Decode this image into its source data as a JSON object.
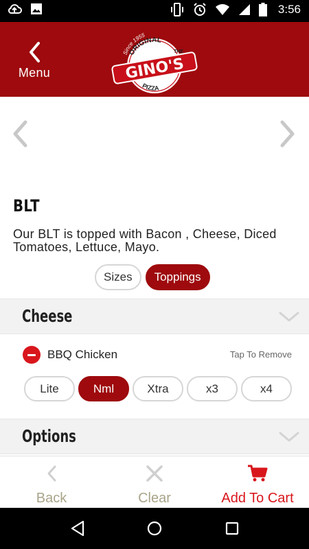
{
  "status_bar": {
    "time": "3:56",
    "icons": [
      "cloud-upload-icon",
      "image-icon",
      "vibrate-icon",
      "alarm-icon",
      "wifi-icon",
      "signal-icon",
      "battery-icon"
    ]
  },
  "header": {
    "back_label": "Menu",
    "logo": {
      "since": "Since 1955",
      "the": "THE",
      "original": "ORIGINAL",
      "brand": "GINO'S",
      "pizza": "PIZZA"
    }
  },
  "item": {
    "title": "BLT",
    "description": "Our BLT is topped with Bacon , Cheese, Diced Tomatoes, Lettuce, Mayo."
  },
  "tabs": [
    {
      "label": "Sizes",
      "active": false
    },
    {
      "label": "Toppings",
      "active": true
    }
  ],
  "sections": {
    "cheese": "Cheese",
    "options": "Options"
  },
  "topping": {
    "name": "BBQ Chicken",
    "hint": "Tap To Remove",
    "amounts": [
      {
        "label": "Lite",
        "active": false
      },
      {
        "label": "Nml",
        "active": true
      },
      {
        "label": "Xtra",
        "active": false
      },
      {
        "label": "x3",
        "active": false
      },
      {
        "label": "x4",
        "active": false
      }
    ]
  },
  "actions": {
    "back": "Back",
    "clear": "Clear",
    "add_to_cart": "Add To Cart"
  },
  "colors": {
    "brand_red": "#9e0a0d",
    "accent_red": "#d8161c",
    "muted_text": "#a9a48a"
  }
}
